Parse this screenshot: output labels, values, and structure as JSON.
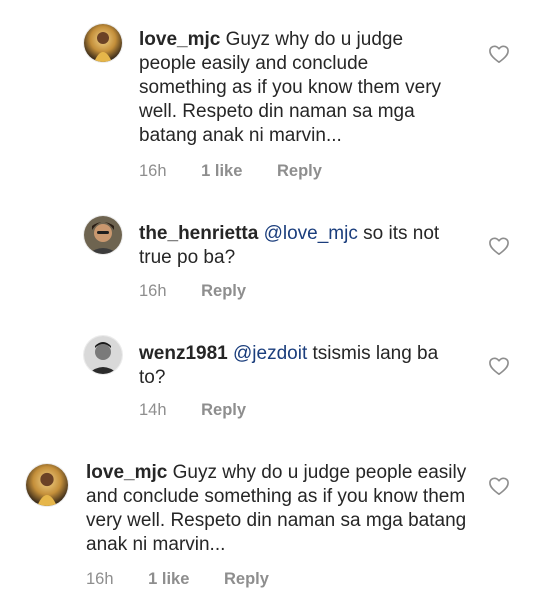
{
  "comments": [
    {
      "username": "love_mjc",
      "mention": "",
      "text": "Guyz why do u judge people easily and conclude something as if you know them very well. Respeto din naman sa mga batang anak ni marvin...",
      "time": "16h",
      "likes": "1 like",
      "reply_label": "Reply"
    },
    {
      "username": "the_henrietta",
      "mention": "@love_mjc",
      "text": "so its not true po ba?",
      "time": "16h",
      "likes": "",
      "reply_label": "Reply"
    },
    {
      "username": "wenz1981",
      "mention": "@jezdoit",
      "text": "tsismis lang ba to?",
      "time": "14h",
      "likes": "",
      "reply_label": "Reply"
    },
    {
      "username": "love_mjc",
      "mention": "",
      "text": "Guyz why do u judge people easily and conclude something as if you know them very well. Respeto din naman sa mga batang anak ni marvin...",
      "time": "16h",
      "likes": "1 like",
      "reply_label": "Reply"
    }
  ],
  "icons": {
    "like": "heart-outline-icon",
    "avatar_1": "avatar-image",
    "avatar_2": "avatar-image",
    "avatar_3": "avatar-image",
    "avatar_4": "avatar-image"
  },
  "colors": {
    "text": "#262626",
    "meta": "#8e8e8e",
    "mention": "#1a3d7c"
  }
}
